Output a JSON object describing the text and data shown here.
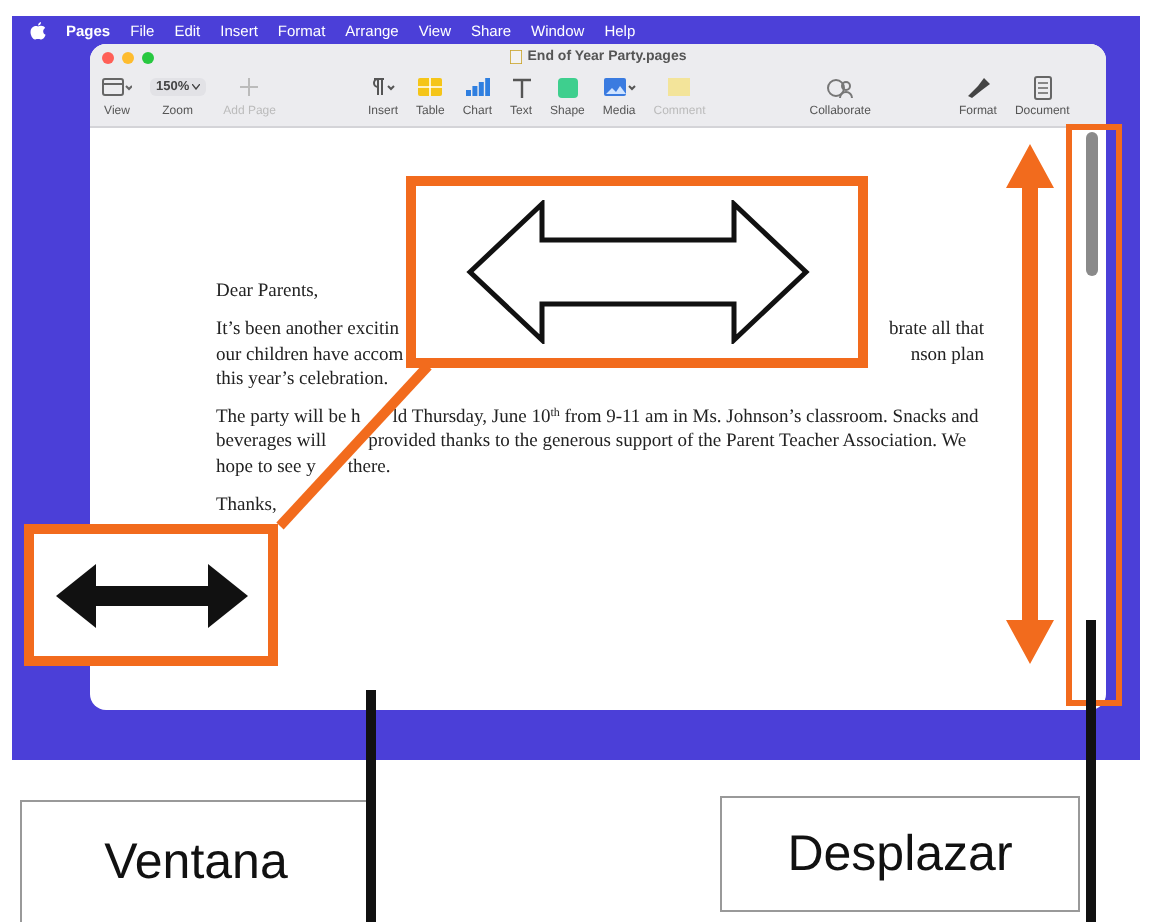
{
  "menu_bar": {
    "app": "Pages",
    "items": [
      "File",
      "Edit",
      "Insert",
      "Format",
      "Arrange",
      "View",
      "Share",
      "Window",
      "Help"
    ]
  },
  "window": {
    "title": "End of Year Party.pages"
  },
  "toolbar": [
    {
      "kind": "view",
      "label": "View",
      "disabled": false
    },
    {
      "kind": "zoom",
      "label": "Zoom",
      "value": "150%",
      "disabled": false
    },
    {
      "kind": "add",
      "label": "Add Page",
      "disabled": true
    },
    {
      "kind": "insert",
      "label": "Insert",
      "disabled": false
    },
    {
      "kind": "table",
      "label": "Table",
      "disabled": false
    },
    {
      "kind": "chart",
      "label": "Chart",
      "disabled": false
    },
    {
      "kind": "text",
      "label": "Text",
      "disabled": false
    },
    {
      "kind": "shape",
      "label": "Shape",
      "disabled": false
    },
    {
      "kind": "media",
      "label": "Media",
      "disabled": false
    },
    {
      "kind": "comment",
      "label": "Comment",
      "disabled": true
    },
    {
      "kind": "collaborate",
      "label": "Collaborate",
      "disabled": false
    },
    {
      "kind": "format",
      "label": "Format",
      "disabled": false
    },
    {
      "kind": "document",
      "label": "Document",
      "disabled": false
    }
  ],
  "document": {
    "greeting": "Dear Parents,",
    "paragraph_1_lines": [
      {
        "left": "It’s been another excitin",
        "right": "brate all that"
      },
      {
        "left": "our children have accom",
        "right": "nson plan"
      },
      {
        "left": "this year’s celebration."
      }
    ],
    "paragraph_2_lines": [
      {
        "left": "The party will be h",
        "right": "ld Thursday, June 10$^{th}$ from 9-11 am in Ms. Johnson’s classroom. Snacks and"
      },
      {
        "left": "beverages will",
        "right": "provided thanks to the generous support of the Parent Teacher Association. We"
      },
      {
        "left": "hope to see y",
        "right": "there."
      }
    ],
    "closing": "Thanks,"
  },
  "callouts": [
    {
      "label": "Ventana"
    },
    {
      "label": "Desplazar"
    }
  ]
}
